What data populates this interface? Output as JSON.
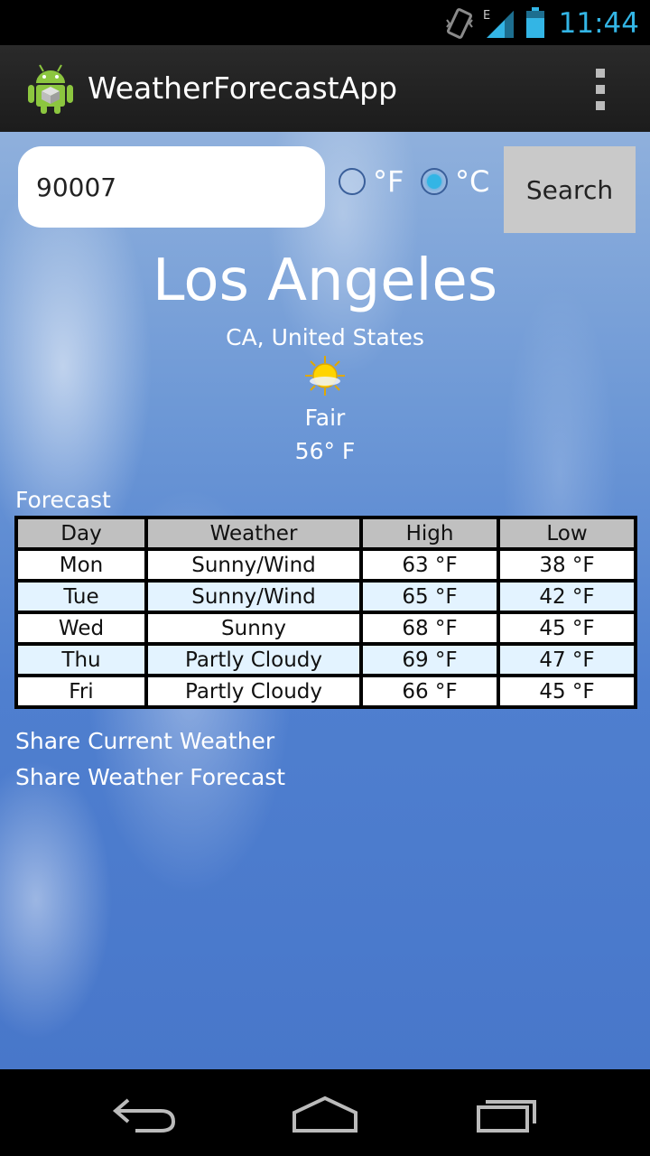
{
  "status_bar": {
    "time": "11:44",
    "network_type": "E",
    "icons": [
      "vibrate-icon",
      "signal-icon",
      "battery-icon"
    ]
  },
  "action_bar": {
    "title": "WeatherForecastApp",
    "app_icon": "android-app-icon",
    "overflow_icon": "overflow-menu-icon"
  },
  "search": {
    "zip_value": "90007",
    "unit_f_label": "°F",
    "unit_c_label": "°C",
    "selected_unit": "°C",
    "button_label": "Search"
  },
  "current": {
    "city": "Los Angeles",
    "region": "CA, United States",
    "icon": "sun-icon",
    "condition": "Fair",
    "temperature": "56° F"
  },
  "forecast": {
    "label": "Forecast",
    "headers": [
      "Day",
      "Weather",
      "High",
      "Low"
    ],
    "rows": [
      {
        "day": "Mon",
        "weather": "Sunny/Wind",
        "high": "63 °F",
        "low": "38 °F"
      },
      {
        "day": "Tue",
        "weather": "Sunny/Wind",
        "high": "65 °F",
        "low": "42 °F"
      },
      {
        "day": "Wed",
        "weather": "Sunny",
        "high": "68 °F",
        "low": "45 °F"
      },
      {
        "day": "Thu",
        "weather": "Partly Cloudy",
        "high": "69 °F",
        "low": "47 °F"
      },
      {
        "day": "Fri",
        "weather": "Partly Cloudy",
        "high": "66 °F",
        "low": "45 °F"
      }
    ]
  },
  "share": {
    "current_label": "Share Current Weather",
    "forecast_label": "Share Weather Forecast"
  },
  "nav_bar": {
    "icons": [
      "back-icon",
      "home-icon",
      "recent-apps-icon"
    ]
  },
  "colors": {
    "accent": "#33b5e5",
    "sky_blue": "#4f7fcf",
    "header_gray": "#c0c0c0",
    "row_alt": "#e3f3ff"
  }
}
